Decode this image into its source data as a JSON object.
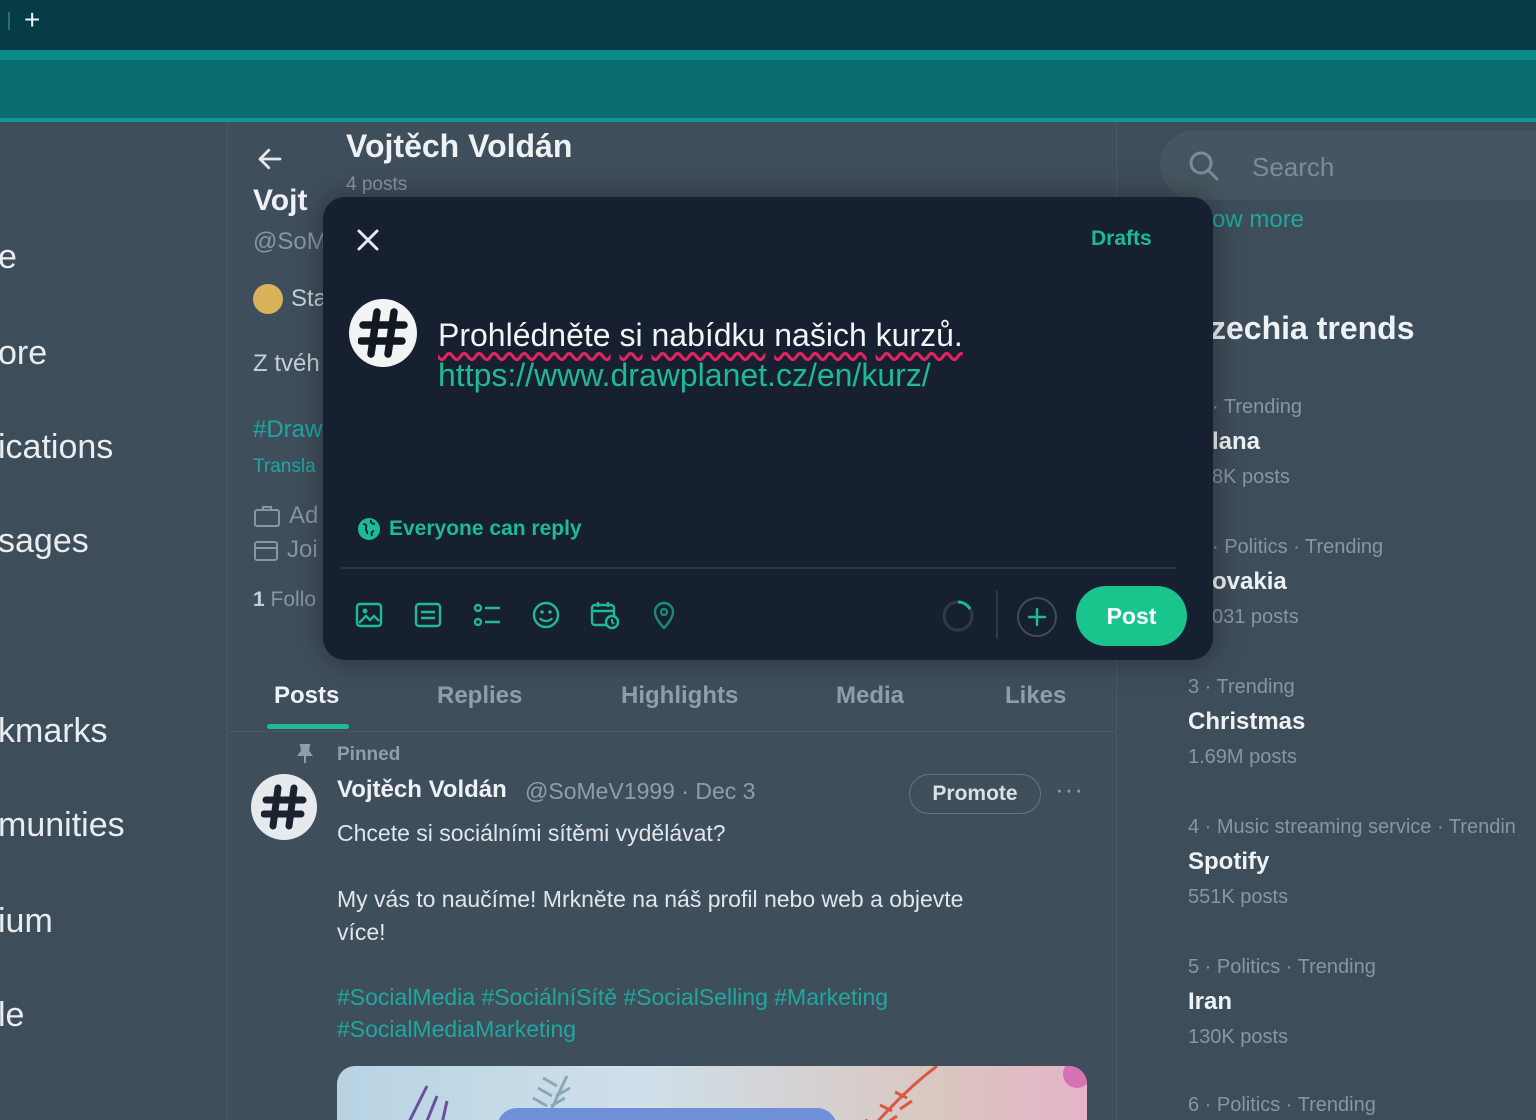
{
  "browser": {
    "new_tab_label": "+"
  },
  "left_nav": {
    "items": [
      {
        "label": "e"
      },
      {
        "label": "ore"
      },
      {
        "label": "ications"
      },
      {
        "label": "sages"
      },
      {
        "label": "kmarks"
      },
      {
        "label": "munities"
      },
      {
        "label": "ium"
      },
      {
        "label": "le"
      }
    ]
  },
  "profile": {
    "back_icon": "arrow-left-icon",
    "title": "Vojtěch Voldán",
    "posts_count": "4 posts",
    "behind_name": "Vojt",
    "behind_handle": "@SoM",
    "behind_status": "Sta",
    "behind_bio": "Z tvéh",
    "behind_tag": "#Draw",
    "behind_translate": "Transla",
    "behind_ad": "Ad",
    "behind_joined": "Joi",
    "behind_follow_count": "1",
    "behind_follow_label": "Follo"
  },
  "tabs": [
    {
      "label": "Posts",
      "active": true
    },
    {
      "label": "Replies"
    },
    {
      "label": "Highlights"
    },
    {
      "label": "Media"
    },
    {
      "label": "Likes"
    }
  ],
  "post": {
    "pinned_label": "Pinned",
    "author": "Vojtěch Voldán",
    "meta": "@SoMeV1999 · Dec 3",
    "promote_label": "Promote",
    "more_label": "···",
    "line1": "Chcete si sociálními sítěmi vydělávat?",
    "line2": "My vás to naučíme! Mrkněte na náš profil nebo web a objevte",
    "line3": "více!",
    "tags_line1": "#SocialMedia #SociálníSítě #SocialSelling #Marketing",
    "tags_line2": "#SocialMediaMarketing"
  },
  "right_column": {
    "search_placeholder": "Search",
    "show_more": "ow more",
    "trends_title": "zechia trends",
    "trends": [
      {
        "category": "· Trending",
        "name": "lana",
        "posts": "8K posts"
      },
      {
        "category": "· Politics · Trending",
        "name": "ovakia",
        "posts": "031 posts"
      },
      {
        "category": "3 · Trending",
        "name": "Christmas",
        "posts": "1.69M posts"
      },
      {
        "category": "4 · Music streaming service · Trendin",
        "name": "Spotify",
        "posts": "551K posts"
      },
      {
        "category": "5 · Politics · Trending",
        "name": "Iran",
        "posts": "130K posts"
      },
      {
        "category": "6 · Politics · Trending",
        "name": "",
        "posts": ""
      }
    ]
  },
  "composer": {
    "drafts_label": "Drafts",
    "text_words": [
      "Prohlédněte",
      "si",
      "nabídku",
      "našich",
      "kurzů."
    ],
    "link": "https://www.drawplanet.cz/en/kurz/",
    "reply_setting": "Everyone can reply",
    "post_label": "Post",
    "tools": [
      "image-icon",
      "gif-icon",
      "poll-icon",
      "emoji-icon",
      "schedule-icon",
      "location-icon"
    ],
    "accent_color": "#1db999"
  }
}
